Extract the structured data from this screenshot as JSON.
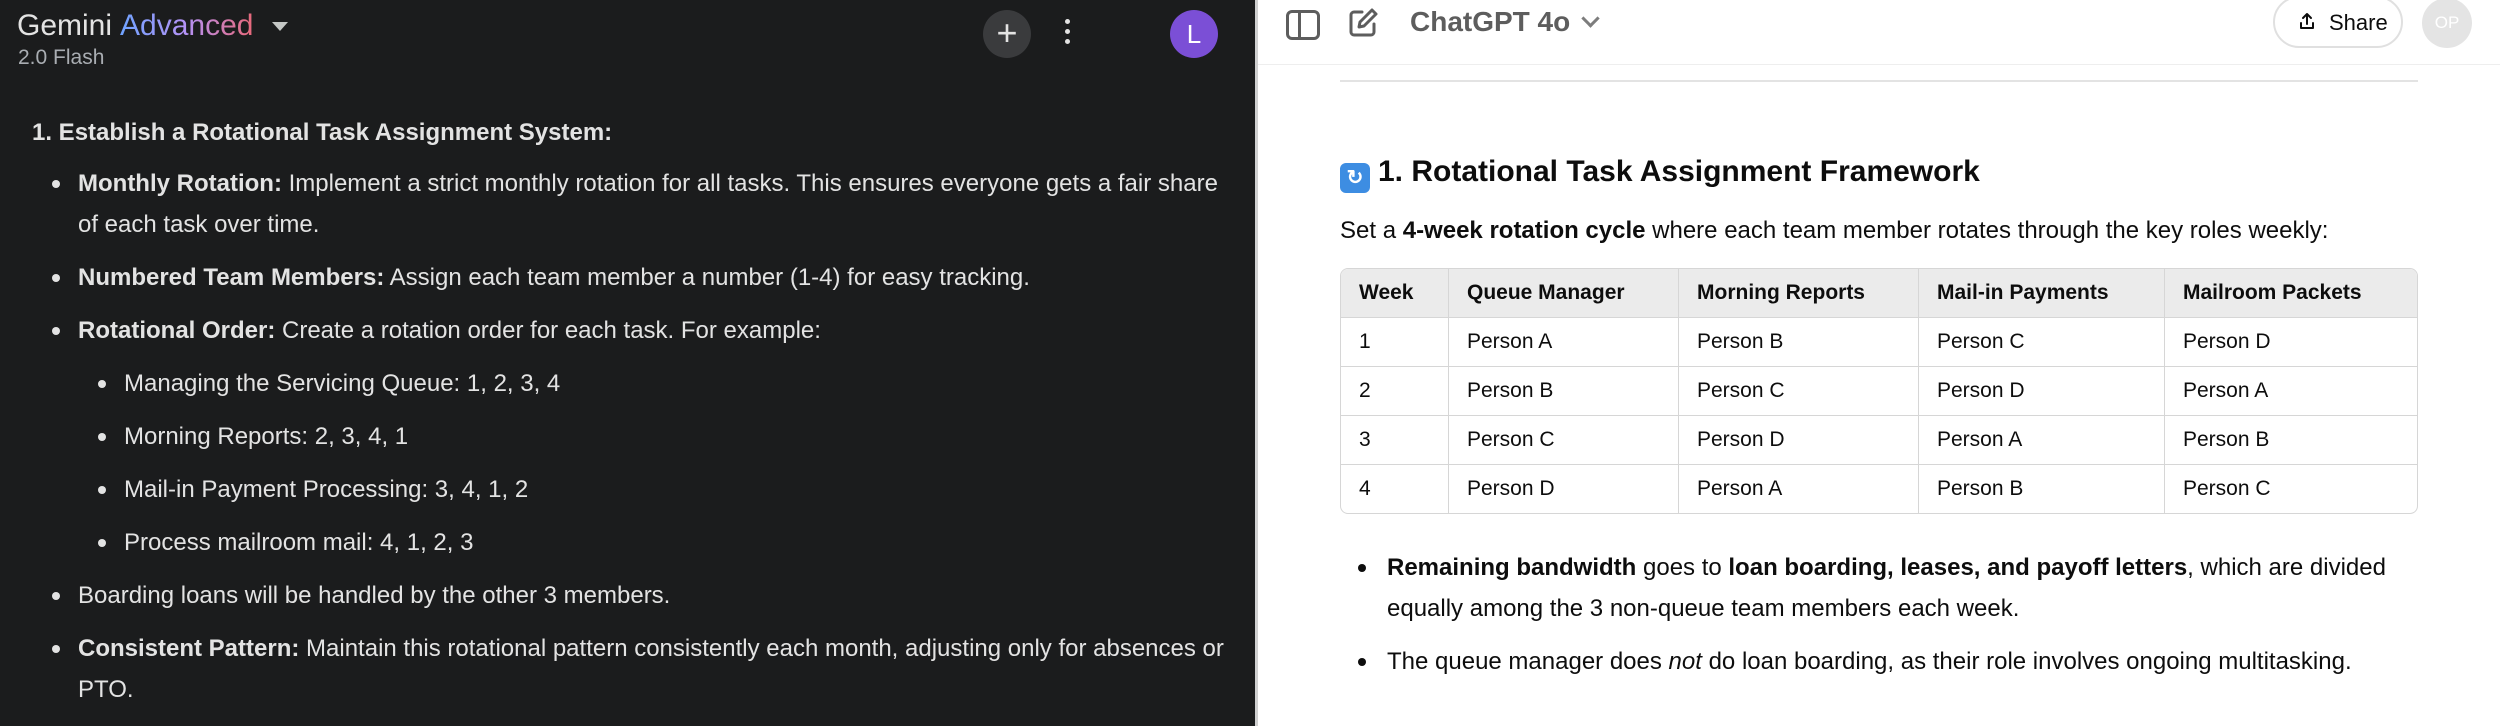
{
  "gemini": {
    "title_name": "Gemini",
    "title_tier": "Advanced",
    "model": "2.0 Flash",
    "avatar_letter": "L",
    "new_chat_icon": "plus-icon",
    "more_icon": "more-vert-icon",
    "heading": "1. Establish a Rotational Task Assignment System:",
    "items": [
      {
        "label": "Monthly Rotation:",
        "text": " Implement a strict monthly rotation for all tasks. This ensures everyone gets a fair share of each task over time."
      },
      {
        "label": "Numbered Team Members:",
        "text": " Assign each team member a number (1-4) for easy tracking."
      },
      {
        "label": "Rotational Order:",
        "text": " Create a rotation order for each task. For example:"
      }
    ],
    "sub_items": [
      "Managing the Servicing Queue: 1, 2, 3, 4",
      "Morning Reports: 2, 3, 4, 1",
      "Mail-in Payment Processing: 3, 4, 1, 2",
      "Process mailroom mail: 4, 1, 2, 3"
    ],
    "plain_item": "Boarding loans will be handled by the other 3 members.",
    "last_item": {
      "label": "Consistent Pattern:",
      "text": " Maintain this rotational pattern consistently each month, adjusting only for absences or PTO."
    }
  },
  "chatgpt": {
    "model": "ChatGPT 4o",
    "share_label": "Share",
    "avatar_initials": "OP",
    "heading_emoji": "🔄",
    "heading": "1. Rotational Task Assignment Framework",
    "intro_pre": "Set a ",
    "intro_bold": "4-week rotation cycle",
    "intro_post": " where each team member rotates through the key roles weekly:",
    "table": {
      "headers": [
        "Week",
        "Queue Manager",
        "Morning Reports",
        "Mail-in Payments",
        "Mailroom Packets"
      ],
      "rows": [
        [
          "1",
          "Person A",
          "Person B",
          "Person C",
          "Person D"
        ],
        [
          "2",
          "Person B",
          "Person C",
          "Person D",
          "Person A"
        ],
        [
          "3",
          "Person C",
          "Person D",
          "Person A",
          "Person B"
        ],
        [
          "4",
          "Person D",
          "Person A",
          "Person B",
          "Person C"
        ]
      ]
    },
    "bullet1": {
      "b1": "Remaining bandwidth",
      "t1": " goes to ",
      "b2": "loan boarding, leases, and payoff letters",
      "t2": ", which are divided equally among the 3 non-queue team members each week."
    },
    "bullet2": {
      "t1": "The queue manager does ",
      "i1": "not",
      "t2": " do loan boarding, as their role involves ongoing multitasking."
    }
  }
}
